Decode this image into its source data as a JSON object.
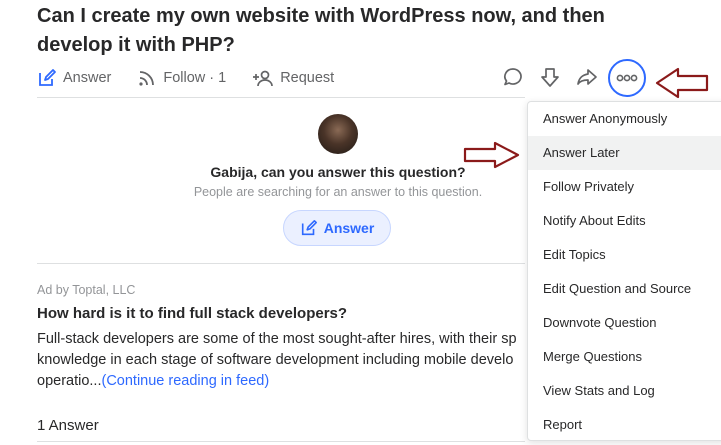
{
  "question": {
    "title": "Can I create my own website with WordPress now, and then develop it with PHP?"
  },
  "actions": {
    "answer_label": "Answer",
    "follow_label": "Follow",
    "follow_count": "· 1",
    "request_label": "Request"
  },
  "prompt": {
    "title": "Gabija, can you answer this question?",
    "subtitle": "People are searching for an answer to this question.",
    "answer_button": "Answer"
  },
  "ad": {
    "label": "Ad by Toptal, LLC",
    "title": "How hard is it to find full stack developers?",
    "body_line1": "Full-stack developers are some of the most sought-after hires, with their sp",
    "body_line2": "knowledge in each stage of software development including mobile develo",
    "body_line3": "operatio...",
    "more_link": "(Continue reading in feed)"
  },
  "answers": {
    "count_label": "1 Answer"
  },
  "menu": {
    "items": [
      "Answer Anonymously",
      "Answer Later",
      "Follow Privately",
      "Notify About Edits",
      "Edit Topics",
      "Edit Question and Source",
      "Downvote Question",
      "Merge Questions",
      "View Stats and Log",
      "Report"
    ],
    "highlighted_index": 1
  },
  "icons": {
    "answer": "pencil-square-icon",
    "follow": "signal-waves-icon",
    "request": "person-plus-icon",
    "comment": "comment-bubble-icon",
    "downvote": "down-arrow-icon",
    "share": "share-arrow-icon",
    "more": "more-dots-icon"
  },
  "colors": {
    "accent": "#2e69ff",
    "annotation_arrow": "#8b1a1a",
    "muted_text": "#636466"
  }
}
